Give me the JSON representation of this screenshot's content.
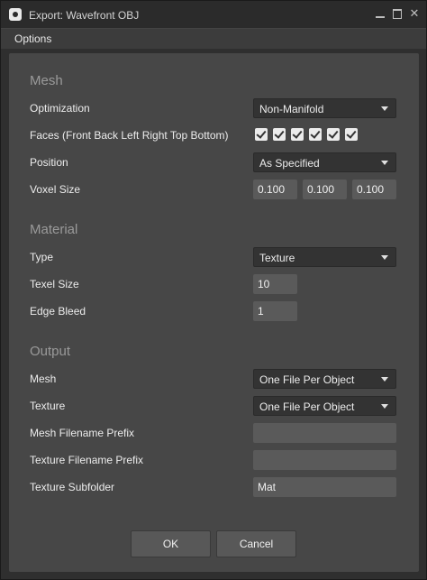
{
  "window": {
    "title": "Export: Wavefront OBJ"
  },
  "menu": {
    "options": "Options"
  },
  "mesh": {
    "heading": "Mesh",
    "optimization_label": "Optimization",
    "optimization_value": "Non-Manifold",
    "faces_label": "Faces (Front Back Left Right Top Bottom)",
    "faces": [
      true,
      true,
      true,
      true,
      true,
      true
    ],
    "position_label": "Position",
    "position_value": "As Specified",
    "voxel_size_label": "Voxel Size",
    "voxel_size": [
      "0.100",
      "0.100",
      "0.100"
    ]
  },
  "material": {
    "heading": "Material",
    "type_label": "Type",
    "type_value": "Texture",
    "texel_size_label": "Texel Size",
    "texel_size": "10",
    "edge_bleed_label": "Edge Bleed",
    "edge_bleed": "1"
  },
  "output": {
    "heading": "Output",
    "mesh_label": "Mesh",
    "mesh_value": "One File Per Object",
    "texture_label": "Texture",
    "texture_value": "One File Per Object",
    "mesh_prefix_label": "Mesh Filename Prefix",
    "mesh_prefix": "",
    "texture_prefix_label": "Texture Filename Prefix",
    "texture_prefix": "",
    "texture_subfolder_label": "Texture Subfolder",
    "texture_subfolder": "Mat"
  },
  "buttons": {
    "ok": "OK",
    "cancel": "Cancel"
  },
  "colors": {
    "panel": "#474747",
    "field": "#5a5a5a",
    "dropdown": "#333333",
    "heading": "#9a9a9a"
  }
}
